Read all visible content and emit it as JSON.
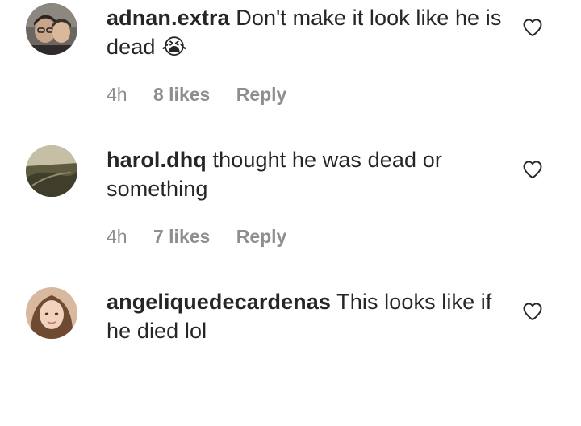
{
  "comments": [
    {
      "username": "adnan.extra",
      "text": "Don't make it look like he is dead 😭",
      "time": "4h",
      "likes": "8 likes",
      "reply": "Reply",
      "avatar_icon": "profile-photo"
    },
    {
      "username": "harol.dhq",
      "text": "thought he was dead or something",
      "time": "4h",
      "likes": "7 likes",
      "reply": "Reply",
      "avatar_icon": "profile-photo"
    },
    {
      "username": "angeliquedecardenas",
      "text": "This looks like if he died lol",
      "avatar_icon": "profile-photo"
    }
  ],
  "colors": {
    "text": "#262626",
    "meta": "#8e8e8e",
    "heart_outline": "#262626"
  },
  "icons": {
    "like": "heart-outline-icon"
  }
}
